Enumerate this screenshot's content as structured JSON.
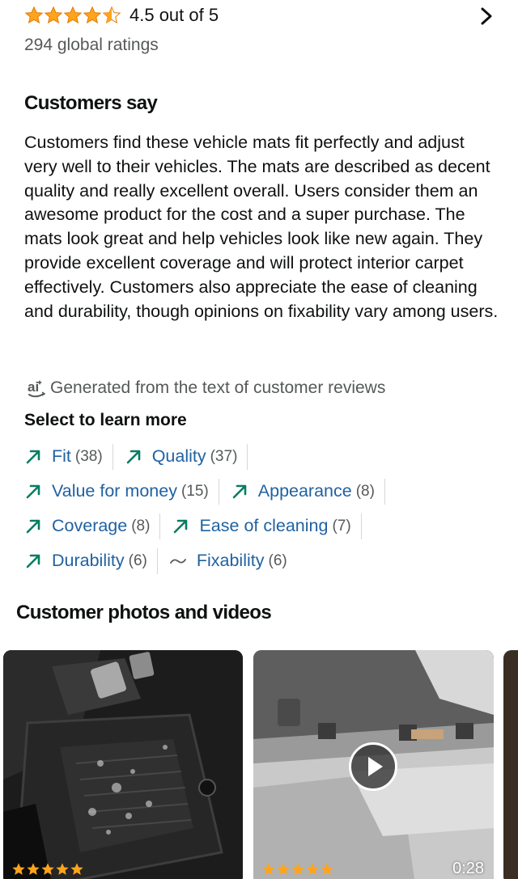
{
  "rating": {
    "stars_value": 4.5,
    "text": "4.5 out of 5",
    "global_ratings": "294 global ratings",
    "chevron_icon": "chevron-right-icon"
  },
  "customers_say": {
    "heading": "Customers say",
    "summary": "Customers find these vehicle mats fit perfectly and adjust very well to their vehicles. The mats are described as decent quality and really excellent overall. Users consider them an awesome product for the cost and a super purchase. The mats look great and help vehicles look like new again. They provide excellent coverage and will protect interior carpet effectively. Customers also appreciate the ease of cleaning and durability, though opinions on fixability vary among users.",
    "ai_note": "Generated from the text of customer reviews",
    "ai_icon": "ai-icon"
  },
  "select": {
    "heading": "Select to learn more",
    "rows": [
      [
        {
          "label": "Fit",
          "count": "(38)",
          "icon": "trend-up-icon"
        },
        {
          "label": "Quality",
          "count": "(37)",
          "icon": "trend-up-icon"
        }
      ],
      [
        {
          "label": "Value for money",
          "count": "(15)",
          "icon": "trend-up-icon"
        },
        {
          "label": "Appearance",
          "count": "(8)",
          "icon": "trend-up-icon"
        }
      ],
      [
        {
          "label": "Coverage",
          "count": "(8)",
          "icon": "trend-up-icon"
        },
        {
          "label": "Ease of cleaning",
          "count": "(7)",
          "icon": "trend-up-icon"
        }
      ],
      [
        {
          "label": "Durability",
          "count": "(6)",
          "icon": "trend-up-icon"
        },
        {
          "label": "Fixability",
          "count": "(6)",
          "icon": "tilde-icon"
        }
      ]
    ]
  },
  "photos": {
    "heading": "Customer photos and videos",
    "items": [
      {
        "stars": 5,
        "type": "photo"
      },
      {
        "stars": 5,
        "type": "video",
        "duration": "0:28"
      }
    ]
  },
  "colors": {
    "star": "#ffa41c",
    "link": "#2162a1",
    "trend_green": "#067d62",
    "muted": "#565959"
  }
}
